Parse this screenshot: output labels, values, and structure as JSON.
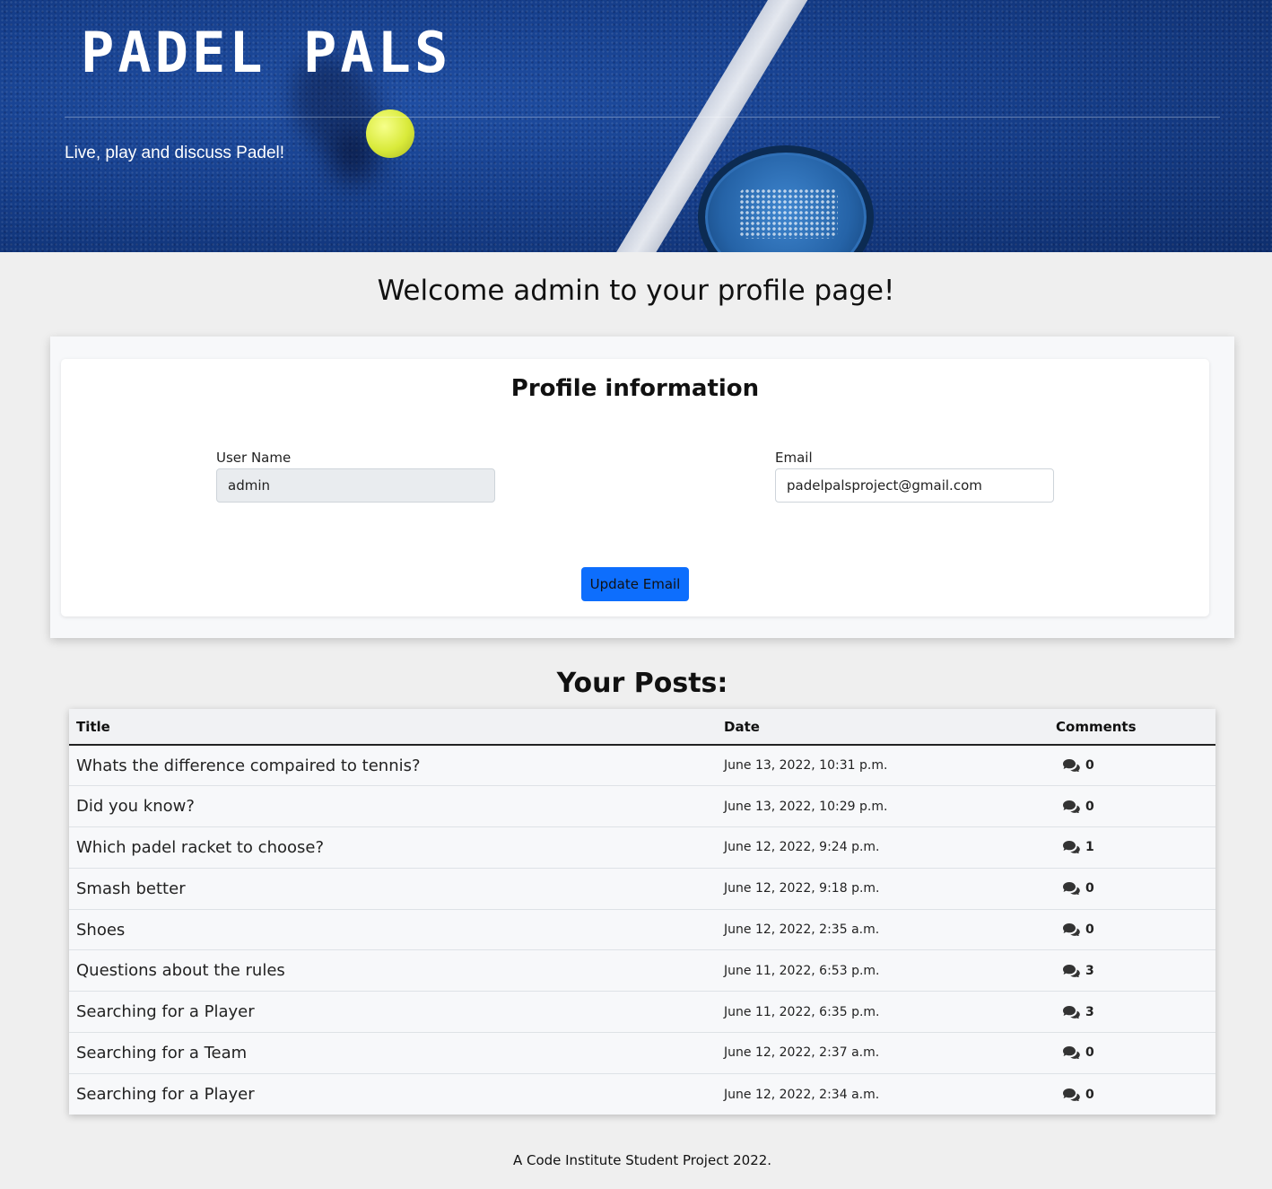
{
  "hero": {
    "title": "PADEL PALS",
    "tagline": "Live, play and discuss Padel!"
  },
  "welcome": "Welcome admin to your profile page!",
  "profile": {
    "heading": "Profile information",
    "username_label": "User Name",
    "username_value": "admin",
    "email_label": "Email",
    "email_value": "padelpalsproject@gmail.com",
    "update_button": "Update Email"
  },
  "posts": {
    "heading": "Your Posts:",
    "columns": {
      "title": "Title",
      "date": "Date",
      "comments": "Comments"
    },
    "rows": [
      {
        "title": "Whats the difference compaired to tennis?",
        "date": "June 13, 2022, 10:31 p.m.",
        "comments": "0"
      },
      {
        "title": "Did you know?",
        "date": "June 13, 2022, 10:29 p.m.",
        "comments": "0"
      },
      {
        "title": "Which padel racket to choose?",
        "date": "June 12, 2022, 9:24 p.m.",
        "comments": "1"
      },
      {
        "title": "Smash better",
        "date": "June 12, 2022, 9:18 p.m.",
        "comments": "0"
      },
      {
        "title": "Shoes",
        "date": "June 12, 2022, 2:35 a.m.",
        "comments": "0"
      },
      {
        "title": "Questions about the rules",
        "date": "June 11, 2022, 6:53 p.m.",
        "comments": "3"
      },
      {
        "title": "Searching for a Player",
        "date": "June 11, 2022, 6:35 p.m.",
        "comments": "3"
      },
      {
        "title": "Searching for a Team",
        "date": "June 12, 2022, 2:37 a.m.",
        "comments": "0"
      },
      {
        "title": "Searching for a Player",
        "date": "June 12, 2022, 2:34 a.m.",
        "comments": "0"
      }
    ]
  },
  "footer": "A Code Institute Student Project 2022.",
  "colors": {
    "hero_blue": "#163f8c",
    "button_blue": "#0d6efd",
    "page_bg": "#efefef"
  },
  "icons": {
    "comments": "comments-icon"
  }
}
